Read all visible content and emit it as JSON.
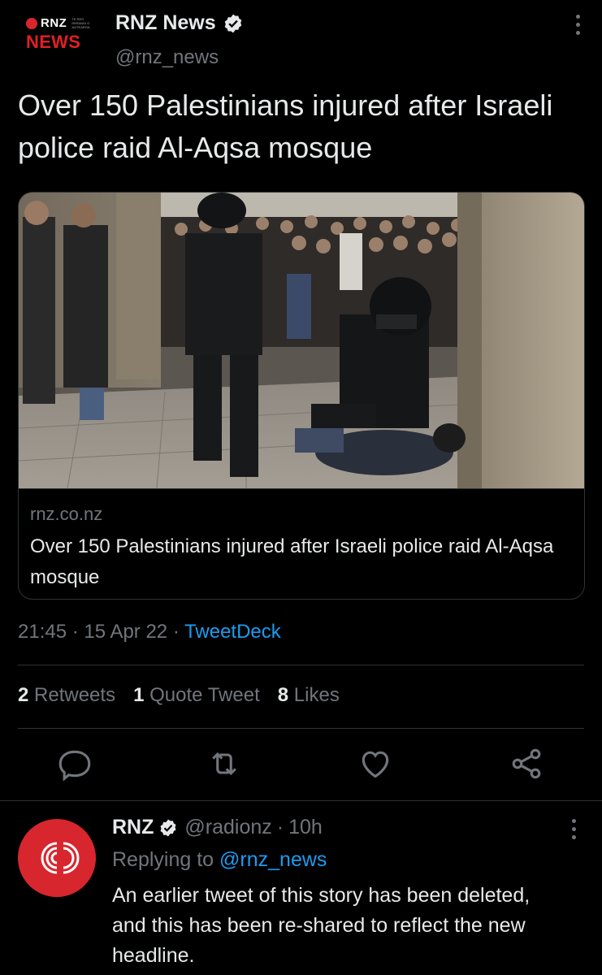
{
  "header": {
    "logo_brand": "RNZ",
    "logo_sub": "TE REO IRIRANGI O AOTEAROA",
    "logo_news": "NEWS",
    "author_name": "RNZ News",
    "handle": "@rnz_news"
  },
  "tweet": {
    "text": "Over 150 Palestinians injured after Israeli police raid Al-Aqsa mosque",
    "time": "21:45",
    "date": "15 Apr 22",
    "source": "TweetDeck",
    "sep": "·"
  },
  "card": {
    "domain": "rnz.co.nz",
    "title": "Over 150 Palestinians injured after Israeli police raid Al-Aqsa mosque"
  },
  "stats": {
    "retweets_count": "2",
    "retweets_label": "Retweets",
    "quotes_count": "1",
    "quotes_label": "Quote Tweet",
    "likes_count": "8",
    "likes_label": "Likes"
  },
  "actions": {
    "icons": [
      "reply-icon",
      "retweet-icon",
      "like-icon",
      "share-icon"
    ]
  },
  "reply": {
    "name": "RNZ",
    "handle": "@radionz",
    "sep": "·",
    "age": "10h",
    "replying_prefix": "Replying to",
    "replying_to": "@rnz_news",
    "text": "An earlier tweet of this story has been deleted, and this has been re-shared to reflect the new headline."
  },
  "colors": {
    "background": "#000000",
    "text": "#e7e9ea",
    "muted": "#71767b",
    "link": "#1d9bf0",
    "brand_red": "#d8262e",
    "border": "#2f3336"
  }
}
